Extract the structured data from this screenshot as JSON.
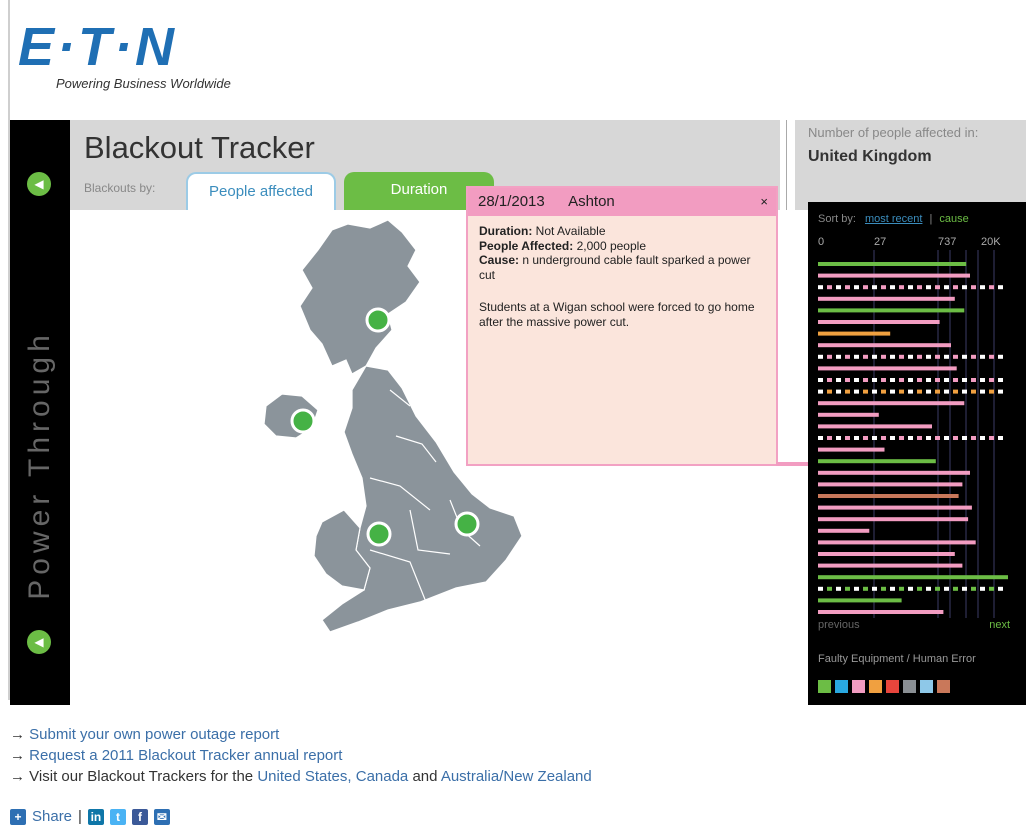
{
  "brand": {
    "name": "E·T·N",
    "tagline": "Powering Business Worldwide"
  },
  "tracker": {
    "title": "Blackout Tracker",
    "blackouts_by_label": "Blackouts by:",
    "tabs": [
      "People affected",
      "Duration"
    ],
    "side_text": "Power Through"
  },
  "affected": {
    "label": "Number of people affected in:",
    "country": "United Kingdom"
  },
  "popup": {
    "date": "28/1/2013",
    "place": "Ashton",
    "close": "×",
    "duration_label": "Duration:",
    "duration_value": "Not Available",
    "people_label": "People Affected:",
    "people_value": "2,000 people",
    "cause_label": "Cause:",
    "cause_value": "n underground cable fault sparked a power cut",
    "story": "Students at a Wigan school were forced to go home after the massive power cut."
  },
  "panel": {
    "sort_label": "Sort by:",
    "sort_recent": "most recent",
    "sort_sep": "|",
    "sort_cause": "cause",
    "ticks": [
      "0",
      "27",
      "737",
      "20K"
    ],
    "previous": "previous",
    "next": "next",
    "legend_label": "Faulty Equipment / Human Error",
    "legend_colors": [
      "#6cbd45",
      "#29a8e0",
      "#f29cc1",
      "#f0a040",
      "#e8453c",
      "#8a8f94",
      "#8ec8e8",
      "#c9785a"
    ]
  },
  "bars": [
    {
      "v": 0.78,
      "c": "#6cbd45"
    },
    {
      "v": 0.8,
      "c": "#f29cc1"
    },
    {
      "v": 1.0,
      "c": "#f29cc1",
      "d": true
    },
    {
      "v": 0.72,
      "c": "#f29cc1"
    },
    {
      "v": 0.77,
      "c": "#6cbd45"
    },
    {
      "v": 0.64,
      "c": "#f29cc1"
    },
    {
      "v": 0.38,
      "c": "#f0a040"
    },
    {
      "v": 0.7,
      "c": "#f29cc1"
    },
    {
      "v": 1.0,
      "c": "#f29cc1",
      "d": true
    },
    {
      "v": 0.73,
      "c": "#f29cc1"
    },
    {
      "v": 1.0,
      "c": "#f29cc1",
      "d": true
    },
    {
      "v": 1.0,
      "c": "#f0a040",
      "d": true
    },
    {
      "v": 0.77,
      "c": "#f29cc1"
    },
    {
      "v": 0.32,
      "c": "#f29cc1"
    },
    {
      "v": 0.6,
      "c": "#f29cc1"
    },
    {
      "v": 1.0,
      "c": "#f29cc1",
      "d": true
    },
    {
      "v": 0.35,
      "c": "#f29cc1"
    },
    {
      "v": 0.62,
      "c": "#6cbd45"
    },
    {
      "v": 0.8,
      "c": "#f29cc1"
    },
    {
      "v": 0.76,
      "c": "#f29cc1"
    },
    {
      "v": 0.74,
      "c": "#c9785a"
    },
    {
      "v": 0.81,
      "c": "#f29cc1"
    },
    {
      "v": 0.79,
      "c": "#f29cc1"
    },
    {
      "v": 0.27,
      "c": "#f29cc1"
    },
    {
      "v": 0.83,
      "c": "#f29cc1"
    },
    {
      "v": 0.72,
      "c": "#f29cc1"
    },
    {
      "v": 0.76,
      "c": "#f29cc1"
    },
    {
      "v": 1.0,
      "c": "#6cbd45"
    },
    {
      "v": 1.0,
      "c": "#6cbd45",
      "d": true
    },
    {
      "v": 0.44,
      "c": "#6cbd45"
    },
    {
      "v": 0.66,
      "c": "#f29cc1"
    }
  ],
  "footer": {
    "link1": "Submit your own power outage report",
    "link2": "Request a 2011 Blackout Tracker annual report",
    "line3_prefix": "Visit our Blackout Trackers for the",
    "us": "United States",
    "comma": ",",
    "canada": "Canada",
    "and": "and",
    "anz": "Australia/New Zealand",
    "arrow": "→",
    "share": "Share",
    "share_sep": "|"
  }
}
